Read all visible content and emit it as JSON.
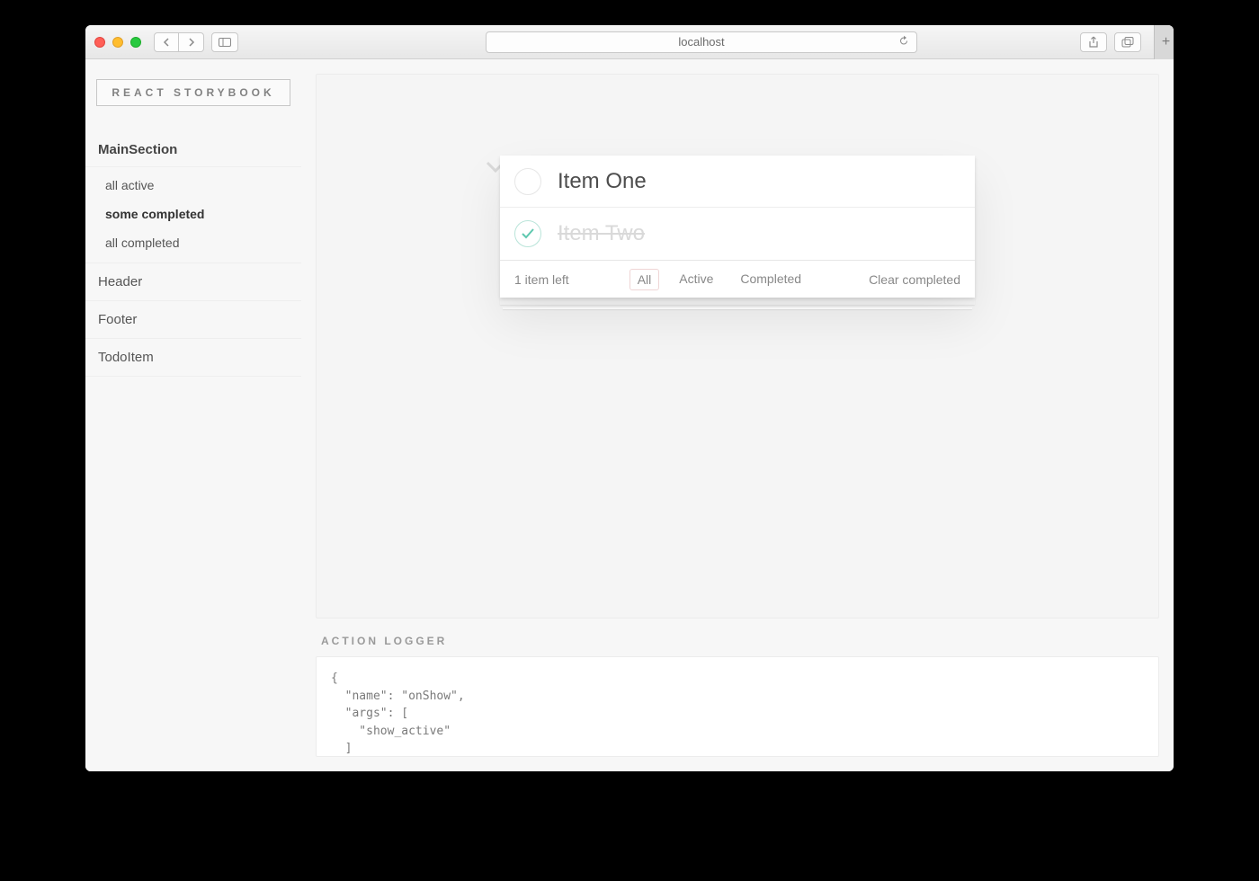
{
  "browser": {
    "url": "localhost"
  },
  "sidebar": {
    "title": "REACT STORYBOOK",
    "sections": [
      {
        "name": "MainSection",
        "stories": [
          {
            "label": "all active",
            "selected": false
          },
          {
            "label": "some completed",
            "selected": true
          },
          {
            "label": "all completed",
            "selected": false
          }
        ]
      },
      {
        "name": "Header"
      },
      {
        "name": "Footer"
      },
      {
        "name": "TodoItem"
      }
    ]
  },
  "todo": {
    "items": [
      {
        "label": "Item One",
        "completed": false
      },
      {
        "label": "Item Two",
        "completed": true
      }
    ],
    "count_label": "1 item left",
    "filters": [
      {
        "label": "All",
        "selected": true
      },
      {
        "label": "Active",
        "selected": false
      },
      {
        "label": "Completed",
        "selected": false
      }
    ],
    "clear_label": "Clear completed"
  },
  "logger": {
    "title": "ACTION LOGGER",
    "body": "{\n  \"name\": \"onShow\",\n  \"args\": [\n    \"show_active\"\n  ]\n}\n\n{"
  }
}
